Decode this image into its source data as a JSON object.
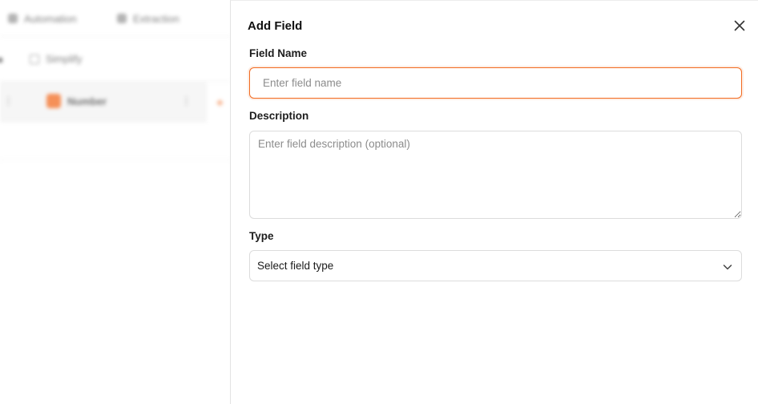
{
  "background_app": {
    "tabs": [
      {
        "label": "Automation",
        "icon": "automation-icon"
      },
      {
        "label": "Extraction",
        "icon": "extraction-icon"
      }
    ],
    "toolbar": {
      "simplify_label": "Simplify",
      "icon": "simplify-icon"
    },
    "column_header": {
      "label": "Number",
      "accent": "#f26b21"
    },
    "add_column_symbol": "+"
  },
  "panel": {
    "title": "Add Field",
    "close_icon": "close-icon",
    "field_name": {
      "label": "Field Name",
      "placeholder": "Enter field name",
      "value": ""
    },
    "description": {
      "label": "Description",
      "placeholder": "Enter field description (optional)",
      "value": ""
    },
    "type": {
      "label": "Type",
      "selected": "Select field type",
      "icon": "chevron-down-icon"
    }
  },
  "colors": {
    "accent": "#f26b21",
    "border": "#dcdcdc",
    "placeholder": "#8c8c8c",
    "text": "#1a1a1a"
  }
}
